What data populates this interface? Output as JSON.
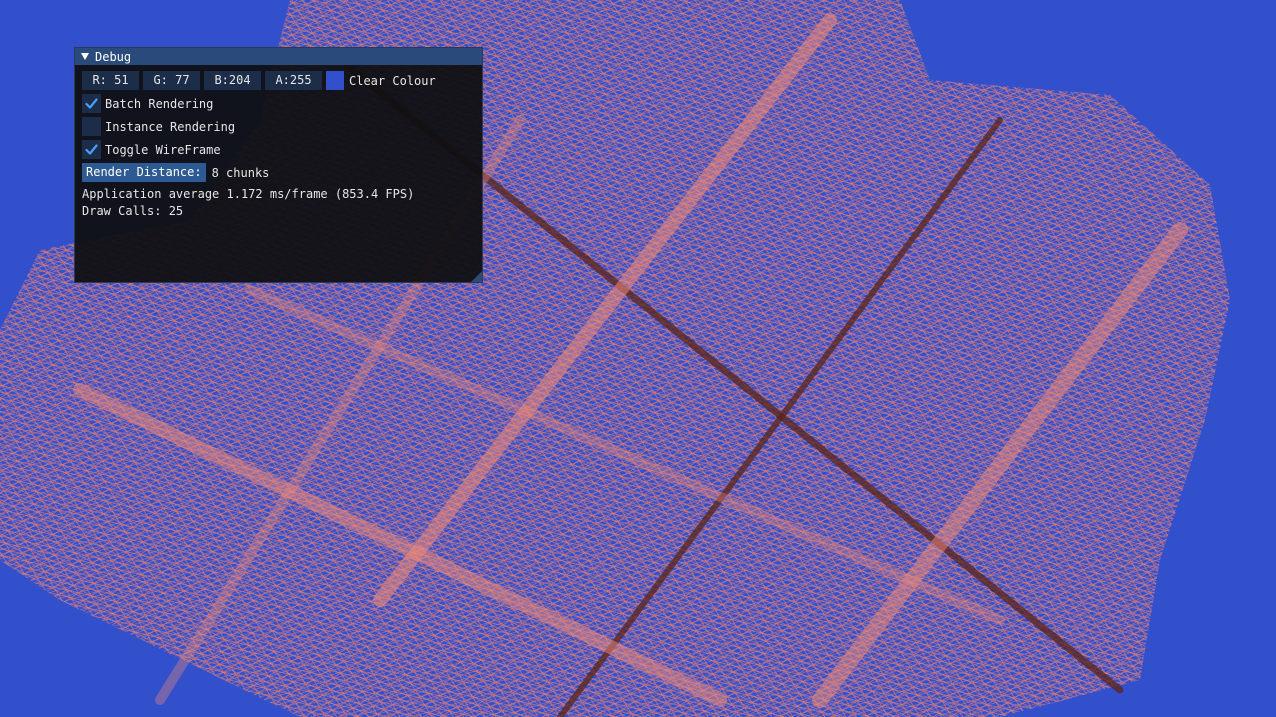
{
  "window": {
    "title": "Debug"
  },
  "clear_colour": {
    "r_label": "R: 51",
    "g_label": "G: 77",
    "b_label": "B:204",
    "a_label": "A:255",
    "swatch_color": "#3350cc",
    "label": "Clear Colour"
  },
  "options": {
    "batch_rendering": {
      "label": "Batch Rendering",
      "checked": true
    },
    "instance_rendering": {
      "label": "Instance Rendering",
      "checked": false
    },
    "toggle_wireframe": {
      "label": "Toggle WireFrame",
      "checked": true
    }
  },
  "render_distance": {
    "button_label": "Render Distance:",
    "value_text": "8 chunks"
  },
  "stats": {
    "fps_text": "Application average 1.172 ms/frame (853.4 FPS)",
    "draw_calls_text": "Draw Calls: 25"
  },
  "scene": {
    "background_color": "#3350cc",
    "terrain_color": "#ef7a6a"
  }
}
